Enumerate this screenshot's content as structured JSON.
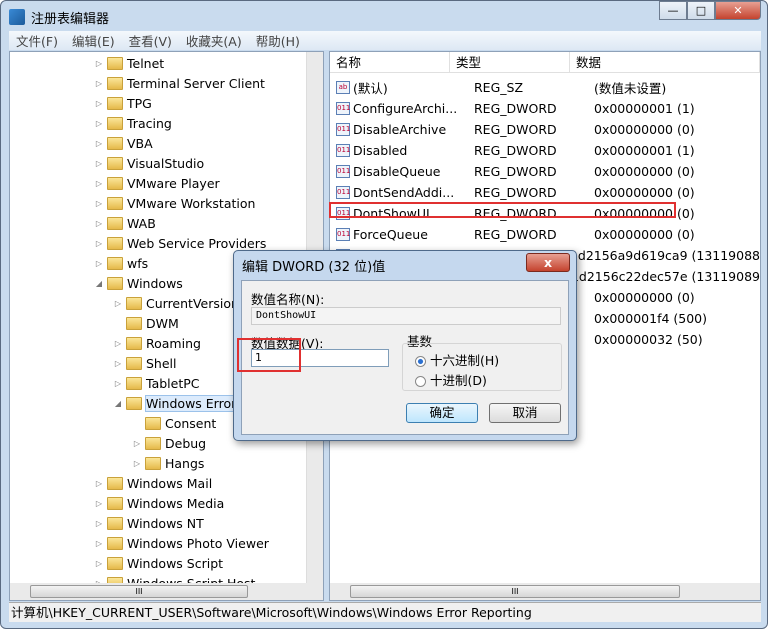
{
  "window": {
    "title": "注册表编辑器",
    "min": "—",
    "max": "□",
    "close": "✕"
  },
  "menu": [
    "文件(F)",
    "编辑(E)",
    "查看(V)",
    "收藏夹(A)",
    "帮助(H)"
  ],
  "tree": [
    {
      "label": "Telnet",
      "level": 1,
      "exp": "▷"
    },
    {
      "label": "Terminal Server Client",
      "level": 1,
      "exp": "▷"
    },
    {
      "label": "TPG",
      "level": 1,
      "exp": "▷"
    },
    {
      "label": "Tracing",
      "level": 1,
      "exp": "▷"
    },
    {
      "label": "VBA",
      "level": 1,
      "exp": "▷"
    },
    {
      "label": "VisualStudio",
      "level": 1,
      "exp": "▷"
    },
    {
      "label": "VMware Player",
      "level": 1,
      "exp": "▷"
    },
    {
      "label": "VMware Workstation",
      "level": 1,
      "exp": "▷"
    },
    {
      "label": "WAB",
      "level": 1,
      "exp": "▷"
    },
    {
      "label": "Web Service Providers",
      "level": 1,
      "exp": "▷"
    },
    {
      "label": "wfs",
      "level": 1,
      "exp": "▷"
    },
    {
      "label": "Windows",
      "level": 1,
      "exp": "◢"
    },
    {
      "label": "CurrentVersion",
      "level": 2,
      "exp": "▷"
    },
    {
      "label": "DWM",
      "level": 2,
      "exp": ""
    },
    {
      "label": "Roaming",
      "level": 2,
      "exp": "▷"
    },
    {
      "label": "Shell",
      "level": 2,
      "exp": "▷"
    },
    {
      "label": "TabletPC",
      "level": 2,
      "exp": "▷"
    },
    {
      "label": "Windows Error",
      "level": 2,
      "exp": "◢",
      "selected": true
    },
    {
      "label": "Consent",
      "level": 3,
      "exp": ""
    },
    {
      "label": "Debug",
      "level": 3,
      "exp": "▷"
    },
    {
      "label": "Hangs",
      "level": 3,
      "exp": "▷"
    },
    {
      "label": "Windows Mail",
      "level": 1,
      "exp": "▷"
    },
    {
      "label": "Windows Media",
      "level": 1,
      "exp": "▷"
    },
    {
      "label": "Windows NT",
      "level": 1,
      "exp": "▷"
    },
    {
      "label": "Windows Photo Viewer",
      "level": 1,
      "exp": "▷"
    },
    {
      "label": "Windows Script",
      "level": 1,
      "exp": "▷"
    },
    {
      "label": "Windows Script Host",
      "level": 1,
      "exp": "▷"
    }
  ],
  "columns": {
    "name": "名称",
    "type": "类型",
    "data": "数据"
  },
  "values": [
    {
      "icon": "ab",
      "name": "(默认)",
      "type": "REG_SZ",
      "data": "(数值未设置)"
    },
    {
      "icon": "011",
      "name": "ConfigureArchi...",
      "type": "REG_DWORD",
      "data": "0x00000001 (1)"
    },
    {
      "icon": "011",
      "name": "DisableArchive",
      "type": "REG_DWORD",
      "data": "0x00000000 (0)"
    },
    {
      "icon": "011",
      "name": "Disabled",
      "type": "REG_DWORD",
      "data": "0x00000001 (1)"
    },
    {
      "icon": "011",
      "name": "DisableQueue",
      "type": "REG_DWORD",
      "data": "0x00000000 (0)"
    },
    {
      "icon": "011",
      "name": "DontSendAddi...",
      "type": "REG_DWORD",
      "data": "0x00000000 (0)"
    },
    {
      "icon": "011",
      "name": "DontShowUI",
      "type": "REG_DWORD",
      "data": "0x00000000 (0)",
      "highlight": true
    },
    {
      "icon": "011",
      "name": "ForceQueue",
      "type": "REG_DWORD",
      "data": "0x00000000 (0)"
    },
    {
      "icon": "011",
      "name": "",
      "type": "",
      "data": "0x1d2156a9d619ca9 (13119088"
    },
    {
      "icon": "011",
      "name": "",
      "type": "",
      "data": "0x1d2156c22dec57e (13119089"
    },
    {
      "icon": "011",
      "name": "",
      "type": "",
      "data": "0x00000000 (0)"
    },
    {
      "icon": "011",
      "name": "",
      "type": "",
      "data": "0x000001f4 (500)"
    },
    {
      "icon": "011",
      "name": "",
      "type": "",
      "data": "0x00000032 (50)"
    }
  ],
  "status": "计算机\\HKEY_CURRENT_USER\\Software\\Microsoft\\Windows\\Windows Error Reporting",
  "dialog": {
    "title": "编辑 DWORD (32 位)值",
    "close": "x",
    "name_label": "数值名称(N):",
    "name_value": "DontShowUI",
    "data_label": "数值数据(V):",
    "data_value": "1",
    "base_label": "基数",
    "hex": "十六进制(H)",
    "dec": "十进制(D)",
    "base_selected": "hex",
    "ok": "确定",
    "cancel": "取消"
  },
  "colors": {
    "highlight_box": "#e03030"
  }
}
